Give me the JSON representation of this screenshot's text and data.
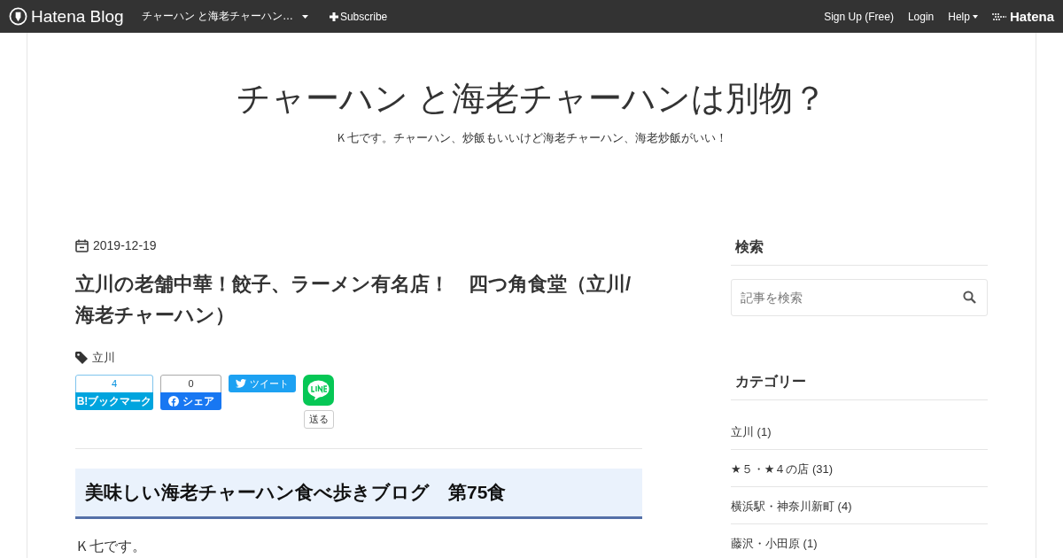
{
  "top_bar": {
    "brand": "Hatena Blog",
    "blog_menu": "チャーハン と海老チャーハン…",
    "subscribe": "Subscribe",
    "links": [
      "Sign Up (Free)",
      "Login"
    ],
    "help": "Help",
    "service": "Hatena"
  },
  "blog": {
    "title": "チャーハン と海老チャーハンは別物？",
    "description": "Ｋ七です。チャーハン、炒飯もいいけど海老チャーハン、海老炒飯がいい！"
  },
  "article": {
    "date": "2019-12-19",
    "title": "立川の老舗中華！餃子、ラーメン有名店！　四つ角食堂（立川/海老チャーハン）",
    "tags": [
      "立川"
    ],
    "share": [
      {
        "kind": "hatena",
        "count": "4",
        "label": "B!ブックマーク"
      },
      {
        "kind": "facebook",
        "count": "0",
        "label": "シェア"
      },
      {
        "kind": "twitter",
        "label": "ツイート"
      },
      {
        "kind": "line",
        "label": "送る"
      }
    ],
    "heading": "美味しい海老チャーハン食べ歩きブログ　第75食",
    "body": "Ｋ七です。"
  },
  "sidebar": {
    "search": {
      "heading": "検索",
      "placeholder": "記事を検索"
    },
    "categories": {
      "heading": "カテゴリー",
      "items": [
        "立川 (1)",
        "★５・★４の店 (31)",
        "横浜駅・神奈川新町 (4)",
        "藤沢・小田原 (1)"
      ]
    }
  }
}
